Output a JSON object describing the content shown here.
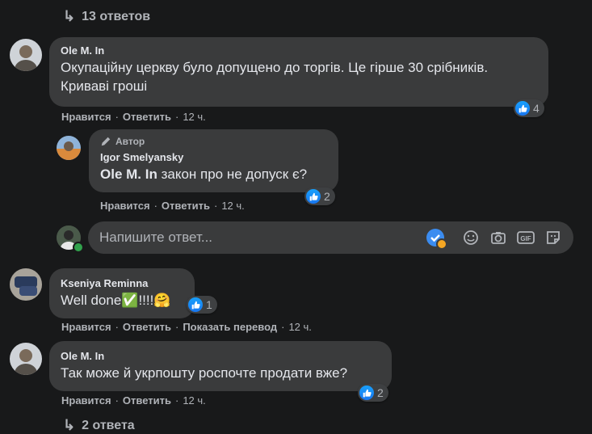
{
  "replies_top": {
    "label": "13 ответов"
  },
  "comments": [
    {
      "author": "Ole M. In",
      "text": "Окупаційну церкву було допущено до торгів. Це гірше 30 срібників. Криваві гроші",
      "like": "Нравится",
      "reply": "Ответить",
      "time": "12 ч.",
      "reactions": "4"
    },
    {
      "badge": "Автор",
      "author": "Igor Smelyansky",
      "mention": "Ole M. In",
      "text": " закон про не допуск є?",
      "like": "Нравится",
      "reply": "Ответить",
      "time": "12 ч.",
      "reactions": "2"
    },
    {
      "author": "Kseniya Reminna",
      "text": "Well done",
      "emoji": "✅!!!!🤗",
      "like": "Нравится",
      "reply": "Ответить",
      "translate": "Показать перевод",
      "time": "12 ч.",
      "reactions": "1"
    },
    {
      "author": "Ole M. In",
      "text": "Так може й укрпошту роспочте продати вже?",
      "like": "Нравится",
      "reply": "Ответить",
      "time": "12 ч.",
      "reactions": "2"
    }
  ],
  "reply_input": {
    "placeholder": "Напишите ответ..."
  },
  "replies_bottom": {
    "label": "2 ответа"
  },
  "icons": {
    "arrow": "reply-arrow-icon",
    "like": "thumbs-up-icon",
    "pen": "pencil-icon",
    "emoji": "smiley-icon",
    "camera": "camera-icon",
    "gif": "gif-icon",
    "sticker": "sticker-icon",
    "check": "grammar-check-icon"
  },
  "colors": {
    "like_blue": "#1877f2",
    "bg": "#18191a",
    "bubble": "#3a3b3c",
    "online": "#31a24c",
    "badge_orange": "#f5a623"
  }
}
